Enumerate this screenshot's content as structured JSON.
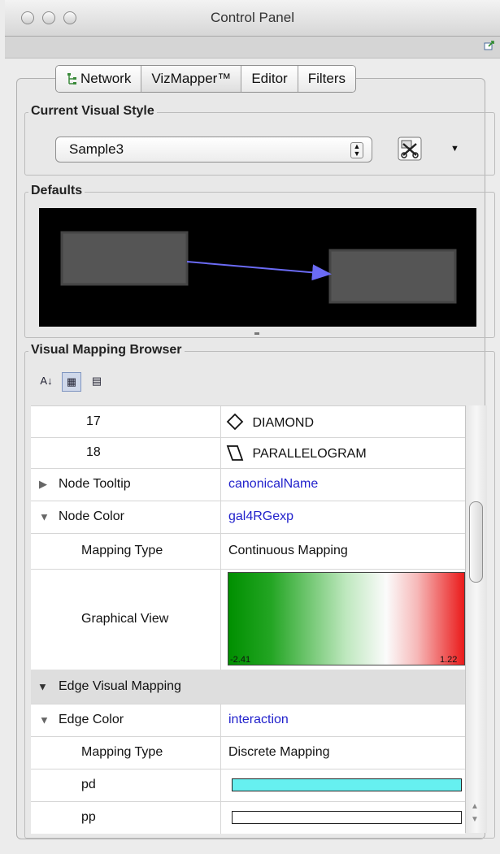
{
  "window": {
    "title": "Control Panel"
  },
  "tabs": [
    {
      "label": "Network",
      "icon": "network-tree-icon"
    },
    {
      "label": "VizMapper™"
    },
    {
      "label": "Editor"
    },
    {
      "label": "Filters"
    }
  ],
  "current_visual_style": {
    "label": "Current Visual Style",
    "selected": "Sample3"
  },
  "defaults": {
    "label": "Defaults",
    "edge_color": "#6b6bf5",
    "node_color": "#555555"
  },
  "browser": {
    "label": "Visual Mapping Browser",
    "rows": {
      "r17": {
        "key": "17",
        "value": "DIAMOND"
      },
      "r18": {
        "key": "18",
        "value": "PARALLELOGRAM"
      },
      "tooltip": {
        "key": "Node Tooltip",
        "value": "canonicalName"
      },
      "ncolor": {
        "key": "Node Color",
        "value": "gal4RGexp"
      },
      "nmaptype": {
        "key": "Mapping Type",
        "value": "Continuous Mapping"
      },
      "gview": {
        "key": "Graphical View",
        "min": "-2.41",
        "max": "1.22"
      },
      "edgevm": {
        "key": "Edge Visual Mapping"
      },
      "ecolor": {
        "key": "Edge Color",
        "value": "interaction"
      },
      "emaptype": {
        "key": "Mapping Type",
        "value": "Discrete Mapping"
      },
      "pd": {
        "key": "pd",
        "color": "#66f0f0"
      },
      "pp": {
        "key": "pp",
        "color": "#ffffff"
      }
    }
  }
}
